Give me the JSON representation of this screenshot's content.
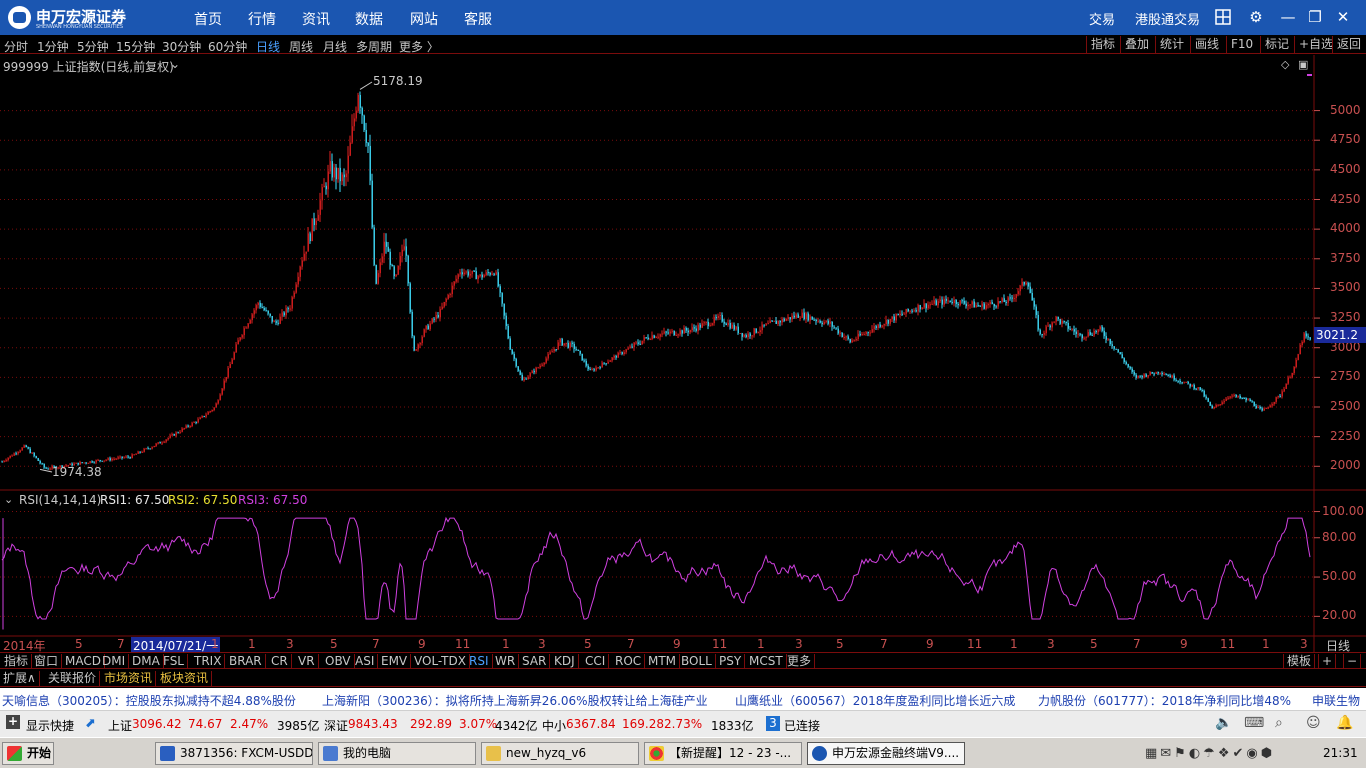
{
  "titlebar": {
    "logo_cn": "申万宏源证券",
    "logo_en": "SHENWAN HONGYUAN SECURITIES",
    "nav": [
      "首页",
      "行情",
      "资讯",
      "数据",
      "网站",
      "客服"
    ],
    "right": [
      "交易",
      "港股通交易"
    ]
  },
  "periods": [
    "分时",
    "1分钟",
    "5分钟",
    "15分钟",
    "30分钟",
    "60分钟",
    "日线",
    "周线",
    "月线",
    "多周期",
    "更多 〉"
  ],
  "active_period": "日线",
  "right_tools": [
    "指标",
    "叠加",
    "统计",
    "画线",
    "F10",
    "标记",
    "+自选",
    "返回"
  ],
  "main_chart": {
    "title": "999999 上证指数(日线,前复权)",
    "high_label": "5178.19",
    "low_label": "1974.38",
    "current_price": "3021.2",
    "price_ticks": [
      "5000",
      "4750",
      "4500",
      "4250",
      "4000",
      "3750",
      "3500",
      "3250",
      "3000",
      "2750",
      "2500",
      "2250",
      "2000"
    ]
  },
  "rsi": {
    "title": "RSI(14,14,14)",
    "rsi1": "RSI1: 67.50",
    "rsi2": "RSI2: 67.50",
    "rsi3": "RSI3: 67.50",
    "ticks": [
      "100.00",
      "80.00",
      "50.00",
      "20.00"
    ]
  },
  "timeaxis": {
    "labels": [
      "2014年",
      "5",
      "7",
      "2014/07/21/一",
      "1",
      "1",
      "3",
      "5",
      "7",
      "9",
      "11",
      "1",
      "3",
      "5",
      "7",
      "9",
      "11",
      "1",
      "3",
      "5",
      "7",
      "9",
      "11",
      "1",
      "3",
      "5",
      "7",
      "9",
      "11",
      "1",
      "3"
    ],
    "period": "日线"
  },
  "indicators": [
    "指标",
    "窗口",
    "MACD",
    "DMI",
    "DMA",
    "FSL",
    "TRIX",
    "BRAR",
    "CR",
    "VR",
    "OBV",
    "ASI",
    "EMV",
    "VOL-TDX",
    "RSI",
    "WR",
    "SAR",
    "KDJ",
    "CCI",
    "ROC",
    "MTM",
    "BOLL",
    "PSY",
    "MCST",
    "更多"
  ],
  "active_indicator": "RSI",
  "ind_right": [
    "模板",
    "+",
    "−"
  ],
  "ext_tabs": [
    "扩展∧",
    "关联报价",
    "市场资讯",
    "板块资讯"
  ],
  "news": [
    "天喻信息（300205）：控股股东拟减持不超4.88%股份",
    "上海新阳（300236）：拟将所持上海新昇26.06%股权转让给上海硅产业",
    "山鹰纸业（600567）2018年度盈利同比增长近六成",
    "力帆股份（601777）：2018年净利同比增48%",
    "申联生物"
  ],
  "status": {
    "shortcut": "显示快捷",
    "sh_name": "上证",
    "sh_value": "3096.42",
    "sh_change": "74.67",
    "sh_pct": "2.47%",
    "sh_amount": "3985亿",
    "sz_name": "深证",
    "sz_value": "9843.43",
    "sz_change": "292.89",
    "sz_pct": "3.07%",
    "sz_amount": "4342亿",
    "zx_name": "中小",
    "zx_value": "6367.84",
    "zx_change": "169.28",
    "zx_pct": "2.73%",
    "zx_amount": "1833亿",
    "conn_num": "3",
    "conn_text": "已连接"
  },
  "taskbar": {
    "start": "开始",
    "tasks": [
      "3871356: FXCM-USDDe...",
      "我的电脑",
      "new_hyzq_v6",
      "【新提醒】12 - 23 -...",
      "申万宏源金融终端V9...."
    ],
    "clock": "21:31"
  },
  "colors": {
    "title_blue": "#1b56b1",
    "up_red": "#e02020",
    "down_cyan": "#40e0ff",
    "rsi_magenta": "#d040e0",
    "grid_red": "#7a0c0c"
  }
}
